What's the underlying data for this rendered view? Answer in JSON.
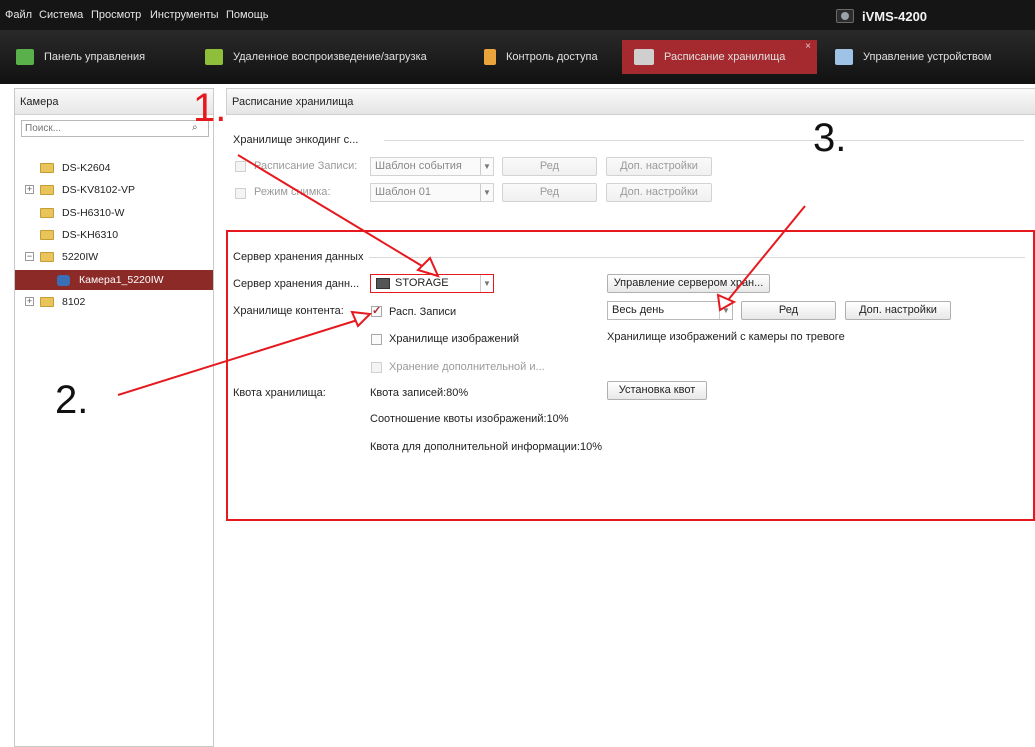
{
  "menu": [
    "Файл",
    "Система",
    "Просмотр",
    "Инструменты",
    "Помощь"
  ],
  "app_name": "iVMS-4200",
  "tabs": [
    {
      "label": "Панель управления",
      "icon": "dashboard-icon",
      "color": "#5ab14c"
    },
    {
      "label": "Удаленное воспроизведение/загрузка",
      "icon": "playback-icon",
      "color": "#8fbf3a"
    },
    {
      "label": "Контроль доступа",
      "icon": "access-control-icon",
      "color": "#e9a43c"
    },
    {
      "label": "Расписание хранилища",
      "icon": "storage-schedule-icon",
      "color": "#cfcfcf",
      "active": true
    },
    {
      "label": "Управление устройством",
      "icon": "device-management-icon",
      "color": "#9fc3e6"
    }
  ],
  "tab_close": "×",
  "sidebar": {
    "title": "Камера",
    "search_placeholder": "Поиск...",
    "tree": [
      {
        "label": "DS-K2604",
        "type": "folder",
        "expander": ""
      },
      {
        "label": "DS-KV8102-VP",
        "type": "folder",
        "expander": "+"
      },
      {
        "label": "DS-H6310-W",
        "type": "folder",
        "expander": ""
      },
      {
        "label": "DS-KH6310",
        "type": "folder",
        "expander": ""
      },
      {
        "label": "5220IW",
        "type": "folder",
        "expander": "−"
      },
      {
        "label": "Камера1_5220IW",
        "type": "camera",
        "expander": "",
        "selected": true
      },
      {
        "label": "8102",
        "type": "folder",
        "expander": "+"
      }
    ]
  },
  "main": {
    "header": "Расписание хранилища",
    "encoding": {
      "title": "Хранилище энкодинг с...",
      "record_label": "Расписание Записи:",
      "record_template": "Шаблон события",
      "snapshot_label": "Режим снимка:",
      "snapshot_template": "Шаблон 01",
      "edit": "Ред",
      "advanced": "Доп. настройки"
    },
    "server": {
      "title": "Сервер хранения данных",
      "server_label": "Сервер хранения данн...",
      "server_value": "STORAGE",
      "manage_button": "Управление сервером хран...",
      "content_label": "Хранилище контента:",
      "record_schedule": "Расп. Записи",
      "record_checked": true,
      "schedule_value": "Весь день",
      "edit": "Ред",
      "advanced": "Доп. настройки",
      "image_storage": "Хранилище изображений",
      "alarm_image_text": "Хранилище изображений с камеры по тревоге",
      "extra_storage": "Хранение дополнительной и...",
      "quota_label": "Квота хранилища:",
      "record_quota": "Квота записей:80%",
      "image_quota": "Соотношение квоты изображений:10%",
      "extra_quota": "Квота для дополнительной информации:10%",
      "quota_button": "Установка квот"
    }
  },
  "annotations": {
    "num1": "1.",
    "num2": "2.",
    "num3": "3.",
    "color": "#e6191e"
  }
}
